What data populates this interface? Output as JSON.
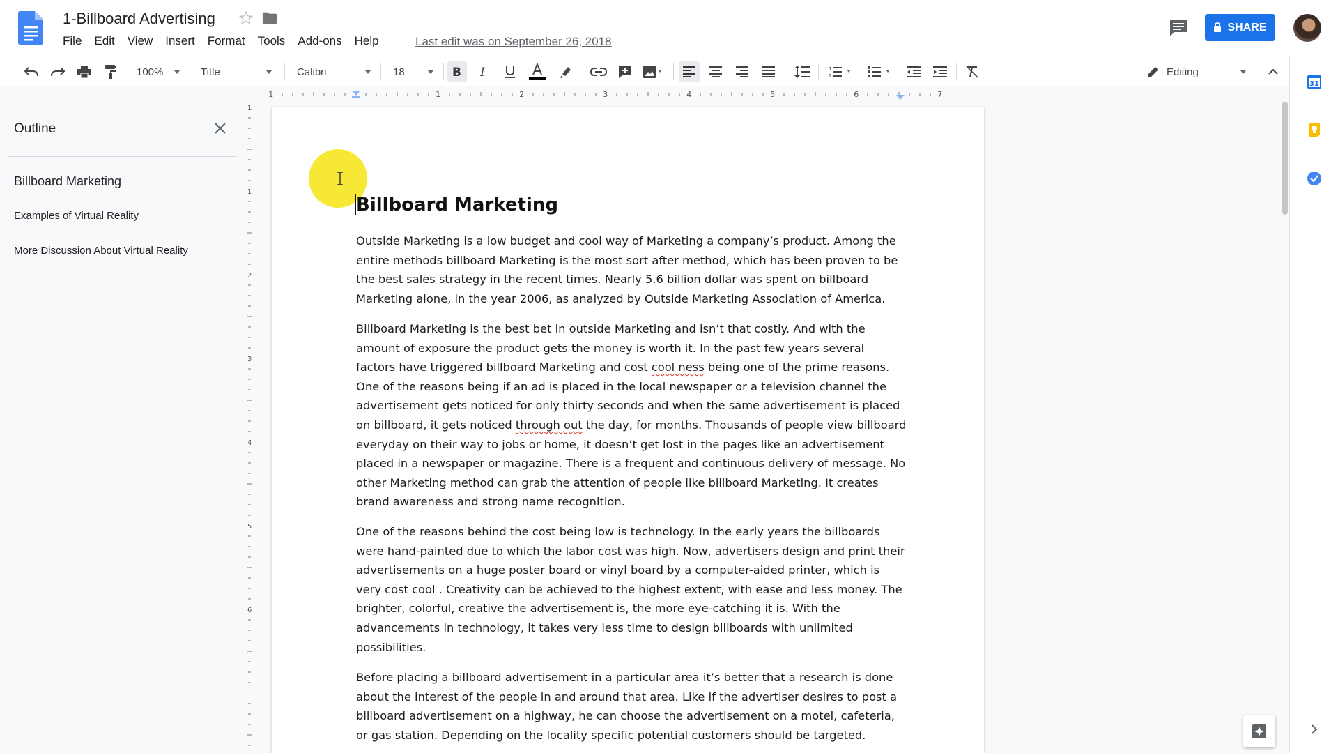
{
  "doc": {
    "title": "1-Billboard Advertising",
    "last_edit": "Last edit was on September 26, 2018"
  },
  "menu": [
    "File",
    "Edit",
    "View",
    "Insert",
    "Format",
    "Tools",
    "Add-ons",
    "Help"
  ],
  "share": {
    "label": "SHARE"
  },
  "toolbar": {
    "zoom": "100%",
    "style": "Title",
    "font": "Calibri",
    "size": "18",
    "mode": "Editing"
  },
  "ruler_labels": [
    "1",
    "1",
    "2",
    "3",
    "4",
    "5",
    "6",
    "7"
  ],
  "vruler_labels": [
    "1",
    "1",
    "2",
    "3",
    "4",
    "5",
    "6"
  ],
  "outline": {
    "title": "Outline",
    "items": [
      "Billboard Marketing",
      "Examples of Virtual Reality",
      "More Discussion About Virtual Reality"
    ]
  },
  "document": {
    "heading": "Billboard Marketing",
    "p1": "Outside Marketing is a low budget and cool  way of Marketing a company’s product. Among the entire methods billboard Marketing is the most sort after method, which has been proven to be the best sales strategy in the recent times. Nearly 5.6 billion dollar was spent on billboard Marketing alone, in the year 2006, as analyzed by Outside Marketing Association of America.",
    "p2_a": "Billboard Marketing is the best bet in outside Marketing and isn’t that costly. And with the amount of exposure the product gets the money is worth it. In the past few years several factors have triggered billboard Marketing and cost ",
    "p2_b": "cool ness",
    "p2_c": " being one of the prime reasons. One of the reasons being if an ad is placed in the local newspaper or a television channel the advertisement gets noticed for only thirty seconds and when the same advertisement is placed on billboard, it gets noticed ",
    "p2_d": "through out",
    "p2_e": " the day, for months. Thousands of people view billboard everyday on their way to jobs or home, it doesn’t get lost in the pages like an advertisement placed in a newspaper or magazine. There is a frequent and continuous delivery of message. No other Marketing method can grab the attention of people like billboard Marketing. It creates brand awareness and strong name recognition.",
    "p3": "One of the reasons behind the cost being low is technology. In the early years the billboards were hand-painted due to which the labor cost was high. Now, advertisers design and print their advertisements on a huge poster board or vinyl board by a computer-aided printer, which is very cost cool . Creativity can be achieved to the highest extent, with ease and less money. The brighter, colorful, creative the advertisement is, the more eye-catching it is. With the advancements in technology, it takes very less time to design billboards with unlimited possibilities.",
    "p4": "Before placing a billboard advertisement in a particular area it’s better that a research is done about the interest of the people in and around that area. Like if the advertiser desires to post a billboard advertisement on a highway, he can choose the advertisement on a motel, cafeteria, or gas station. Depending on the locality specific potential customers should be targeted."
  },
  "colors": {
    "share_blue": "#1a73e8",
    "docs_blue": "#4285f4",
    "highlight_yellow": "#f5e61f",
    "spell_red": "#d93025"
  },
  "icons": [
    "docs-logo-icon",
    "star-icon",
    "folder-icon",
    "comments-icon",
    "lock-icon",
    "undo-icon",
    "redo-icon",
    "print-icon",
    "paint-format-icon",
    "bold-icon",
    "italic-icon",
    "underline-icon",
    "text-color-icon",
    "highlight-icon",
    "link-icon",
    "insert-comment-icon",
    "image-icon",
    "align-left-icon",
    "align-center-icon",
    "align-right-icon",
    "justify-icon",
    "line-spacing-icon",
    "numbered-list-icon",
    "bulleted-list-icon",
    "decrease-indent-icon",
    "increase-indent-icon",
    "clear-formatting-icon",
    "pencil-icon",
    "collapse-icon",
    "calendar-icon",
    "keep-icon",
    "tasks-icon",
    "explore-icon",
    "chevron-right-icon"
  ]
}
